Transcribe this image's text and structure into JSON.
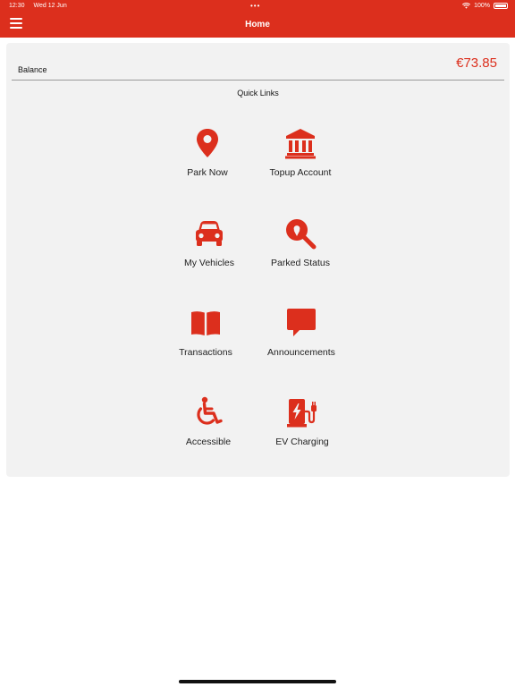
{
  "status_bar": {
    "time": "12:30",
    "date": "Wed 12 Jun",
    "battery": "100%"
  },
  "header": {
    "title": "Home",
    "menu_icon": "hamburger-menu-icon"
  },
  "balance": {
    "label": "Balance",
    "amount": "€73.85"
  },
  "quick_links": {
    "title": "Quick Links",
    "items": [
      {
        "label": "Park Now",
        "icon": "map-pin-icon"
      },
      {
        "label": "Topup Account",
        "icon": "bank-icon"
      },
      {
        "label": "My Vehicles",
        "icon": "car-icon"
      },
      {
        "label": "Parked Status",
        "icon": "search-icon"
      },
      {
        "label": "Transactions",
        "icon": "book-icon"
      },
      {
        "label": "Announcements",
        "icon": "speech-bubble-icon"
      },
      {
        "label": "Accessible",
        "icon": "wheelchair-icon"
      },
      {
        "label": "EV Charging",
        "icon": "ev-charger-icon"
      }
    ]
  },
  "colors": {
    "brand": "#dc2f1d",
    "card_background": "#f2f2f2"
  }
}
